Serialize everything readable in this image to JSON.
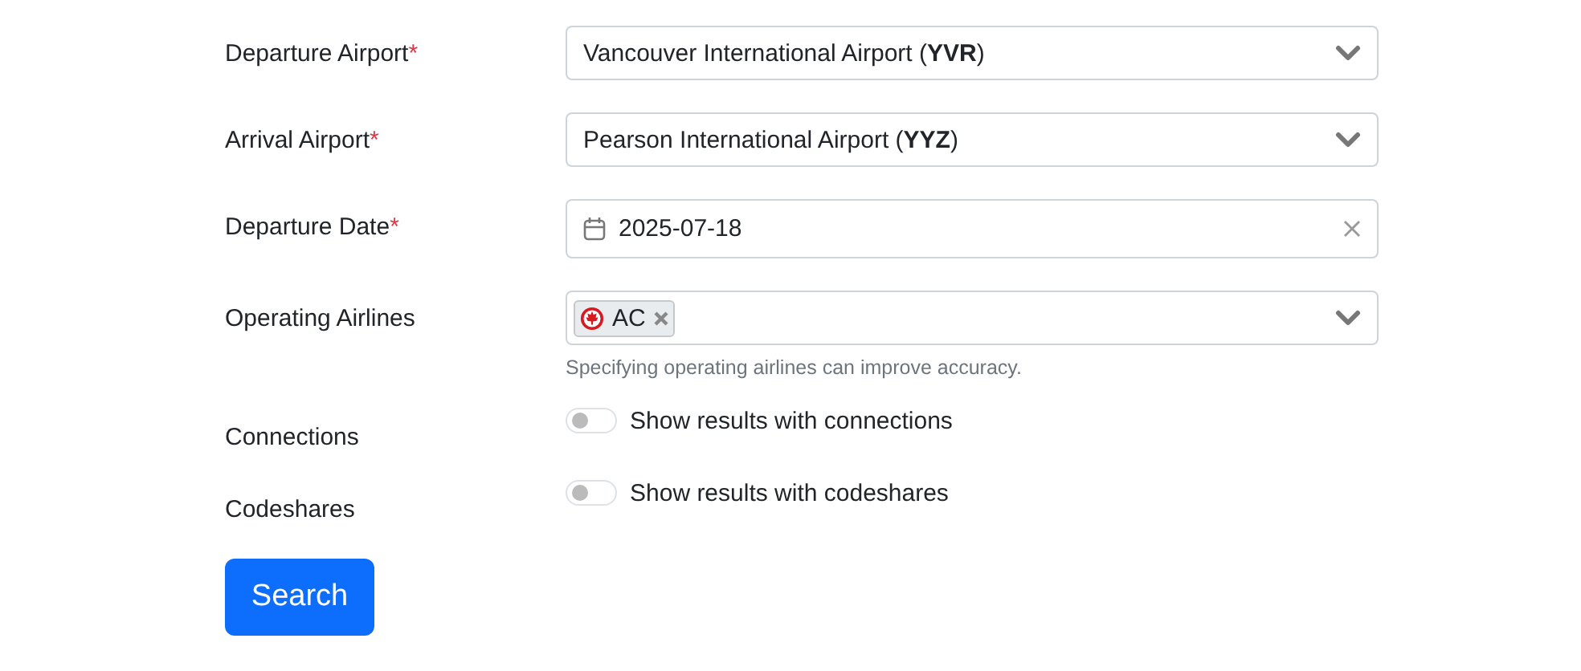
{
  "fields": [
    {
      "kind": "select",
      "label": "Departure Airport",
      "mark": "*",
      "value": "Vancouver International Airport (**YVR**)"
    },
    {
      "kind": "select",
      "label": "Arrival Airport",
      "mark": "*",
      "value": "Pearson International Airport (**YYZ**)"
    },
    {
      "kind": "date",
      "label": "Departure Date",
      "mark": "*",
      "value": "2025-07-18"
    },
    {
      "kind": "tags",
      "label": "Operating Airlines",
      "tags": [
        "AC"
      ],
      "help": "Specifying operating airlines can improve accuracy."
    },
    {
      "kind": "toggle",
      "label": "Connections",
      "text": "Show results with connections",
      "on": false
    },
    {
      "kind": "toggle",
      "label": "Codeshares",
      "text": "Show results with codeshares",
      "on": false
    }
  ],
  "submit": "Search"
}
